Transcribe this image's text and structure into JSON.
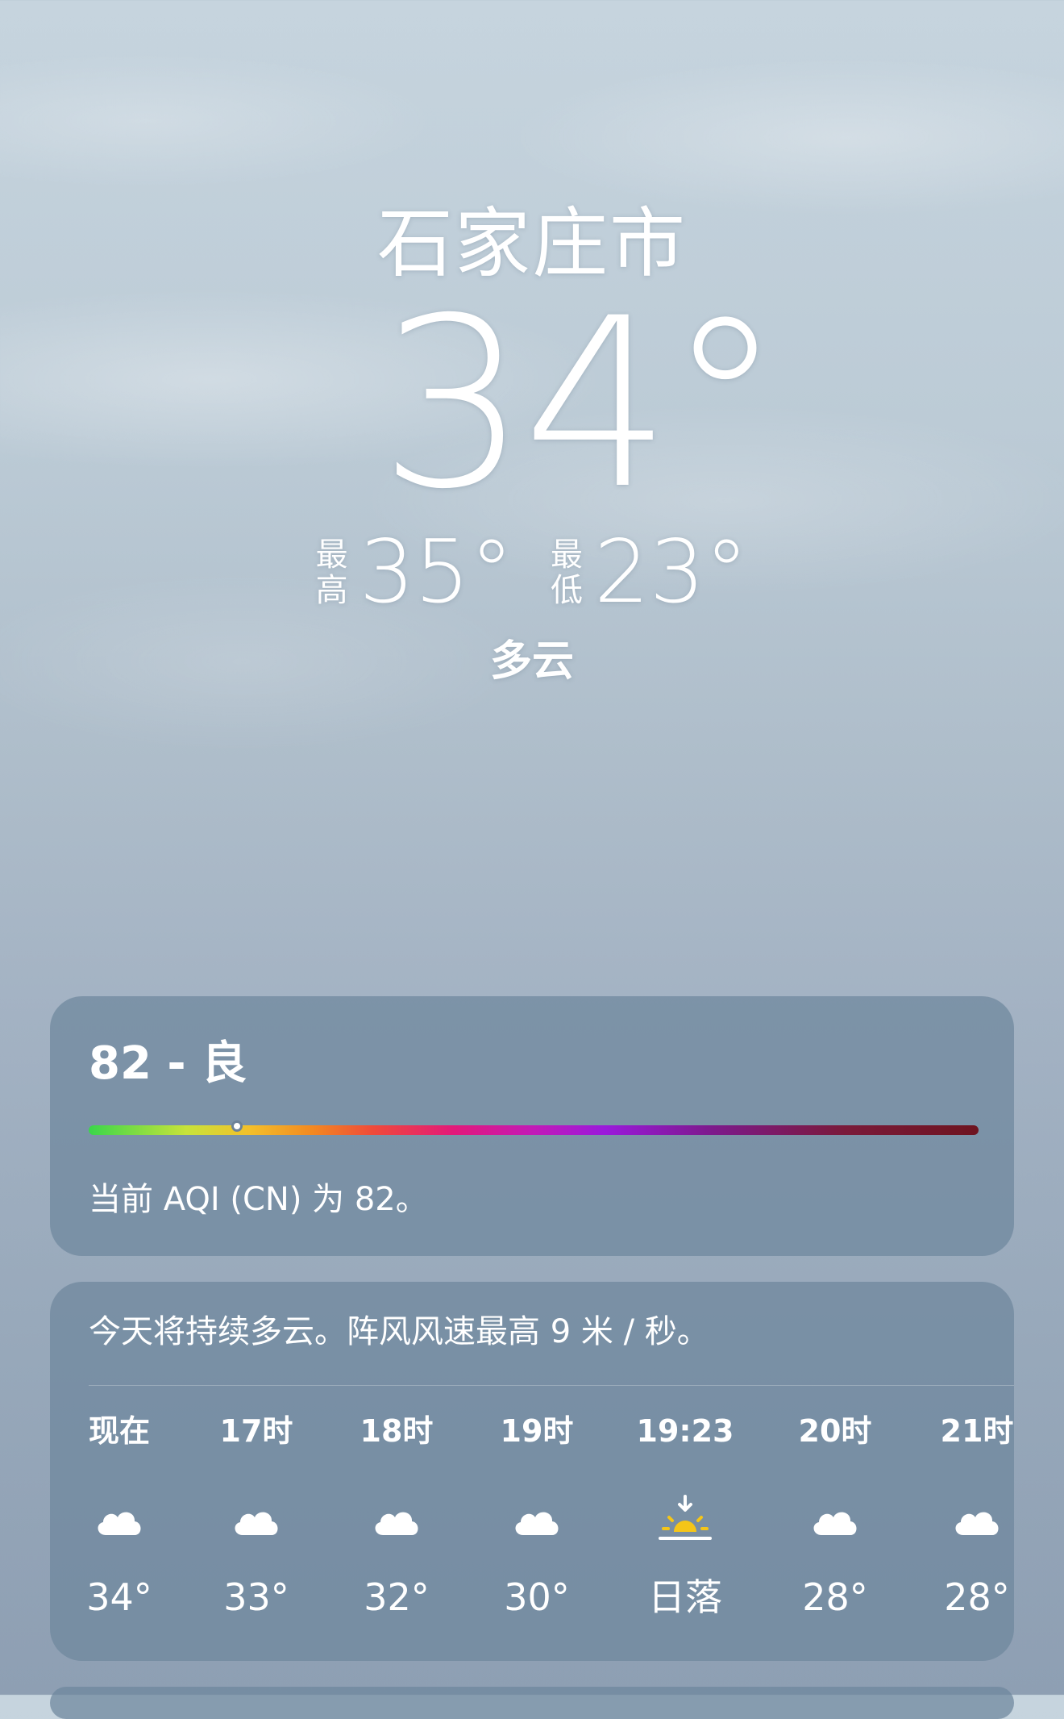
{
  "location": {
    "city": "石家庄市",
    "current_temp": "34°",
    "high_label": "最高",
    "high_temp": "35°",
    "low_label": "最低",
    "low_temp": "23°",
    "condition": "多云"
  },
  "aqi": {
    "title": "82 - 良",
    "description": "当前 AQI (CN) 为 82。",
    "marker_fraction": 0.167
  },
  "forecast": {
    "summary": "今天将持续多云。阵风风速最高 9 米 / 秒。",
    "hours": [
      {
        "time": "现在",
        "icon": "cloud-icon",
        "temp": "34°"
      },
      {
        "time": "17时",
        "icon": "cloud-icon",
        "temp": "33°"
      },
      {
        "time": "18时",
        "icon": "cloud-icon",
        "temp": "32°"
      },
      {
        "time": "19时",
        "icon": "cloud-icon",
        "temp": "30°"
      },
      {
        "time": "19:23",
        "icon": "sunset-icon",
        "temp": "日落"
      },
      {
        "time": "20时",
        "icon": "cloud-icon",
        "temp": "28°"
      },
      {
        "time": "21时",
        "icon": "cloud-icon",
        "temp": "28°"
      }
    ]
  },
  "colors": {
    "card_background": "#7089a0",
    "sun_yellow": "#f5c518",
    "text": "#ffffff"
  }
}
